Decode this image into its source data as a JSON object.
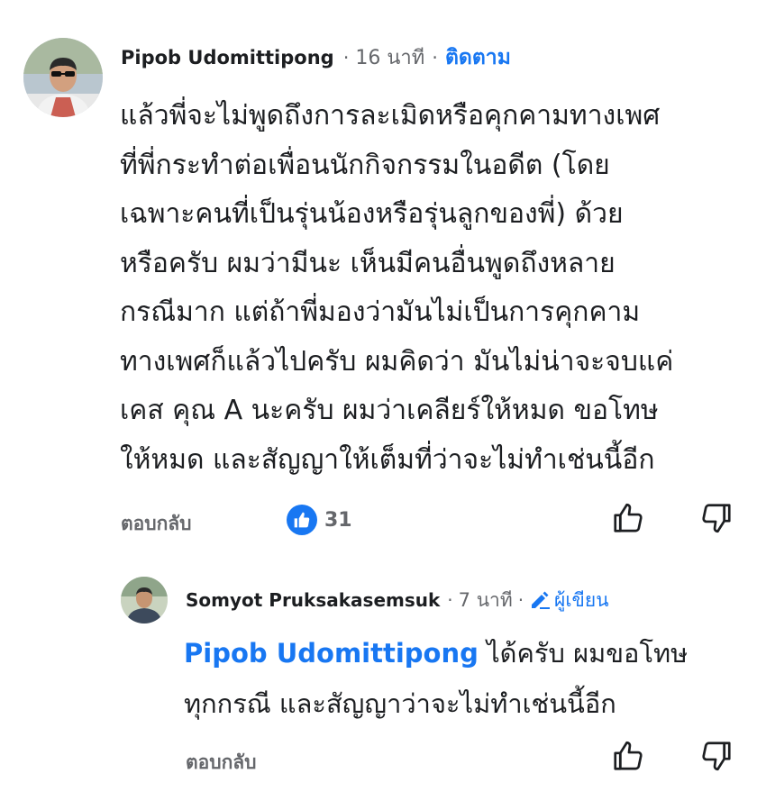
{
  "comment": {
    "author": "Pipob Udomittipong",
    "separator": "·",
    "time": "16 นาที",
    "follow_label": "ติดตาม",
    "text_lines": [
      "แล้วพี่จะไม่พูดถึงการละเมิดหรือคุกคามทางเพศ",
      "ที่พี่กระทำต่อเพื่อนนักกิจกรรมในอดีต (โดย",
      "เฉพาะคนที่เป็นรุ่นน้องหรือรุ่นลูกของพี่) ด้วย",
      "หรือครับ ผมว่ามีนะ เห็นมีคนอื่นพูดถึงหลาย",
      "กรณีมาก แต่ถ้าพี่มองว่ามันไม่เป็นการคุกคาม",
      "ทางเพศก็แล้วไปครับ ผมคิดว่า มันไม่น่าจะจบแค่",
      "เคส คุณ A นะครับ ผมว่าเคลียร์ให้หมด ขอโทษ",
      "ให้หมด และสัญญาให้เต็มที่ว่าจะไม่ทำเช่นนี้อีก"
    ],
    "reply_label": "ตอบกลับ",
    "like_count": "31",
    "like_icon": "thumbs-up-icon",
    "dislike_icon": "thumbs-down-icon"
  },
  "reply": {
    "author": "Somyot Pruksakasemsuk",
    "separator": "·",
    "time": "7 นาที",
    "separator2": "·",
    "author_badge": "ผู้เขียน",
    "badge_icon": "pencil-icon",
    "mention": "Pipob Udomittipong",
    "text_first": " ได้ครับ ผมขอโทษ",
    "text_second": "ทุกกรณี และสัญญาว่าจะไม่ทำเช่นนี้อีก",
    "reply_label": "ตอบกลับ",
    "like_icon": "thumbs-up-icon",
    "dislike_icon": "thumbs-down-icon"
  },
  "colors": {
    "accent": "#1877f2",
    "secondary_text": "#65676b",
    "primary_text": "#1c1e21"
  }
}
